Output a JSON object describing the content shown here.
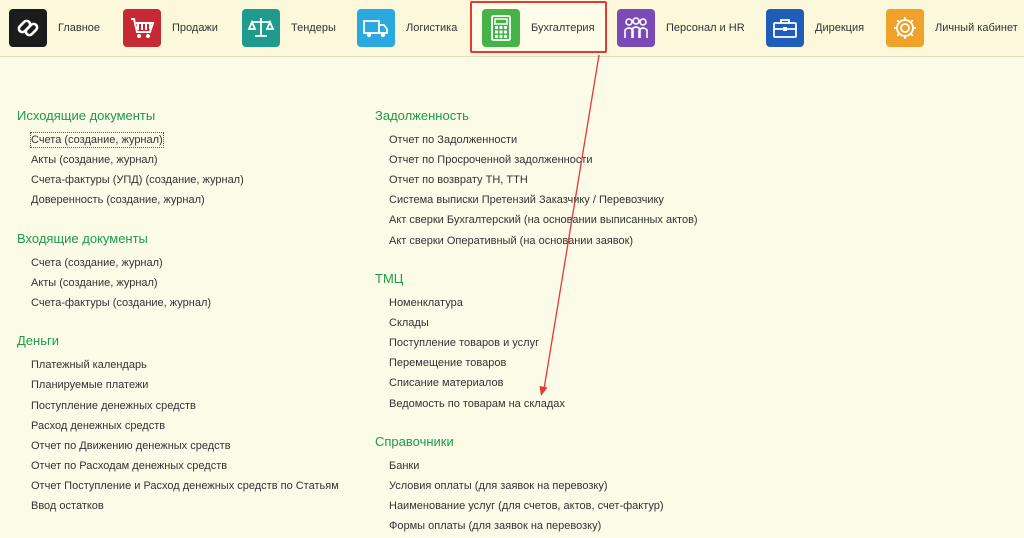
{
  "sections": [
    {
      "label": "Главное",
      "icon": "link-icon",
      "color": "#1c1c1c"
    },
    {
      "label": "Продажи",
      "icon": "cart-icon",
      "color": "#c62834"
    },
    {
      "label": "Тендеры",
      "icon": "scales-icon",
      "color": "#1f9b8e"
    },
    {
      "label": "Логистика",
      "icon": "truck-icon",
      "color": "#29a9e0"
    },
    {
      "label": "Бухгалтерия",
      "icon": "calculator-icon",
      "color": "#46b349"
    },
    {
      "label": "Персонал и HR",
      "icon": "people-icon",
      "color": "#7b4ab7"
    },
    {
      "label": "Дирекция",
      "icon": "briefcase-icon",
      "color": "#1f5db8"
    },
    {
      "label": "Личный кабинет",
      "icon": "gear-icon",
      "color": "#f0a12a"
    }
  ],
  "active_section": "Бухгалтерия",
  "left_column": [
    {
      "title": "Исходящие документы",
      "items": [
        "Счета (создание, журнал)",
        "Акты (создание, журнал)",
        "Счета-фактуры (УПД) (создание, журнал)",
        "Доверенность (создание, журнал)"
      ]
    },
    {
      "title": "Входящие документы",
      "items": [
        "Счета (создание, журнал)",
        "Акты (создание, журнал)",
        "Счета-фактуры (создание, журнал)"
      ]
    },
    {
      "title": "Деньги",
      "items": [
        "Платежный календарь",
        "Планируемые платежи",
        "Поступление денежных средств",
        "Расход денежных средств",
        "Отчет по Движению денежных средств",
        "Отчет по Расходам денежных средств",
        "Отчет Поступление и Расход денежных средств по Статьям",
        "Ввод остатков"
      ]
    }
  ],
  "right_column": [
    {
      "title": "Задолженность",
      "items": [
        "Отчет по Задолженности",
        "Отчет по Просроченной задолженности",
        "Отчет по возврату ТН, ТТН",
        "Система выписки Претензий Заказчику / Перевозчику",
        "Акт сверки Бухгалтерский (на основании выписанных актов)",
        "Акт сверки Оперативный (на основании заявок)"
      ]
    },
    {
      "title": "ТМЦ",
      "items": [
        "Номенклатура",
        "Склады",
        "Поступление товаров и услуг",
        "Перемещение товаров",
        "Списание материалов",
        "Ведомость по товарам на складах"
      ]
    },
    {
      "title": "Справочники",
      "items": [
        "Банки",
        "Условия оплаты (для заявок на перевозку)",
        "Наименование услуг (для счетов, актов, счет-фактур)",
        "Формы оплаты (для заявок на перевозку)"
      ]
    }
  ],
  "colors": {
    "accent_green": "#1f9a4a",
    "highlight_red": "#e53935",
    "background": "#fbfbe8"
  }
}
